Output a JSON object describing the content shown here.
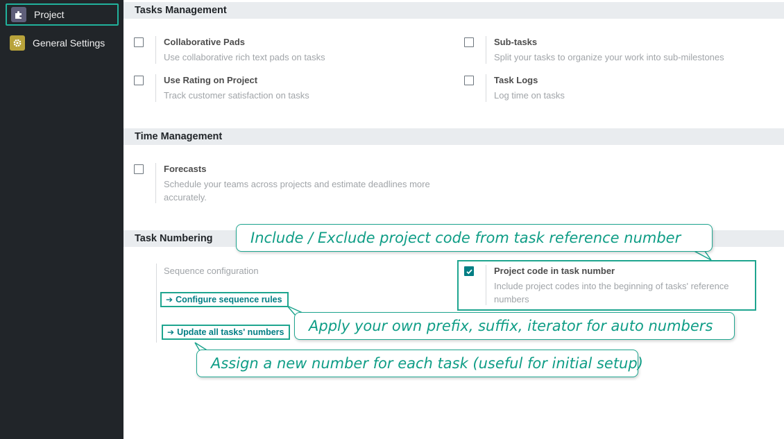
{
  "sidebar": {
    "items": [
      {
        "label": "Project",
        "icon": "puzzle-icon",
        "active": true
      },
      {
        "label": "General Settings",
        "icon": "gear-icon",
        "active": false
      }
    ]
  },
  "sections": {
    "tasks_management": {
      "title": "Tasks Management",
      "settings": [
        {
          "title": "Collaborative Pads",
          "desc": "Use collaborative rich text pads on tasks",
          "checked": false
        },
        {
          "title": "Sub-tasks",
          "desc": "Split your tasks to organize your work into sub-milestones",
          "checked": false
        },
        {
          "title": "Use Rating on Project",
          "desc": "Track customer satisfaction on tasks",
          "checked": false
        },
        {
          "title": "Task Logs",
          "desc": "Log time on tasks",
          "checked": false
        }
      ]
    },
    "time_management": {
      "title": "Time Management",
      "settings": [
        {
          "title": "Forecasts",
          "desc": "Schedule your teams across projects and estimate deadlines more accurately.",
          "checked": false
        }
      ]
    },
    "task_numbering": {
      "title": "Task Numbering",
      "sequence_label": "Sequence configuration",
      "configure_button": "Configure sequence rules",
      "update_button": "Update all tasks' numbers",
      "project_code_setting": {
        "title": "Project code in task number",
        "desc": "Include project codes into the beginning of tasks' reference numbers",
        "checked": true
      }
    }
  },
  "callouts": {
    "include_exclude": "Include / Exclude project code from task reference number",
    "apply_prefix": "Apply your own prefix, suffix, iterator for auto numbers",
    "assign_number": "Assign a new number for each task (useful for initial setup)"
  },
  "colors": {
    "accent": "#1ea58f",
    "primary": "#017e84",
    "sidebar_bg": "#212529"
  }
}
